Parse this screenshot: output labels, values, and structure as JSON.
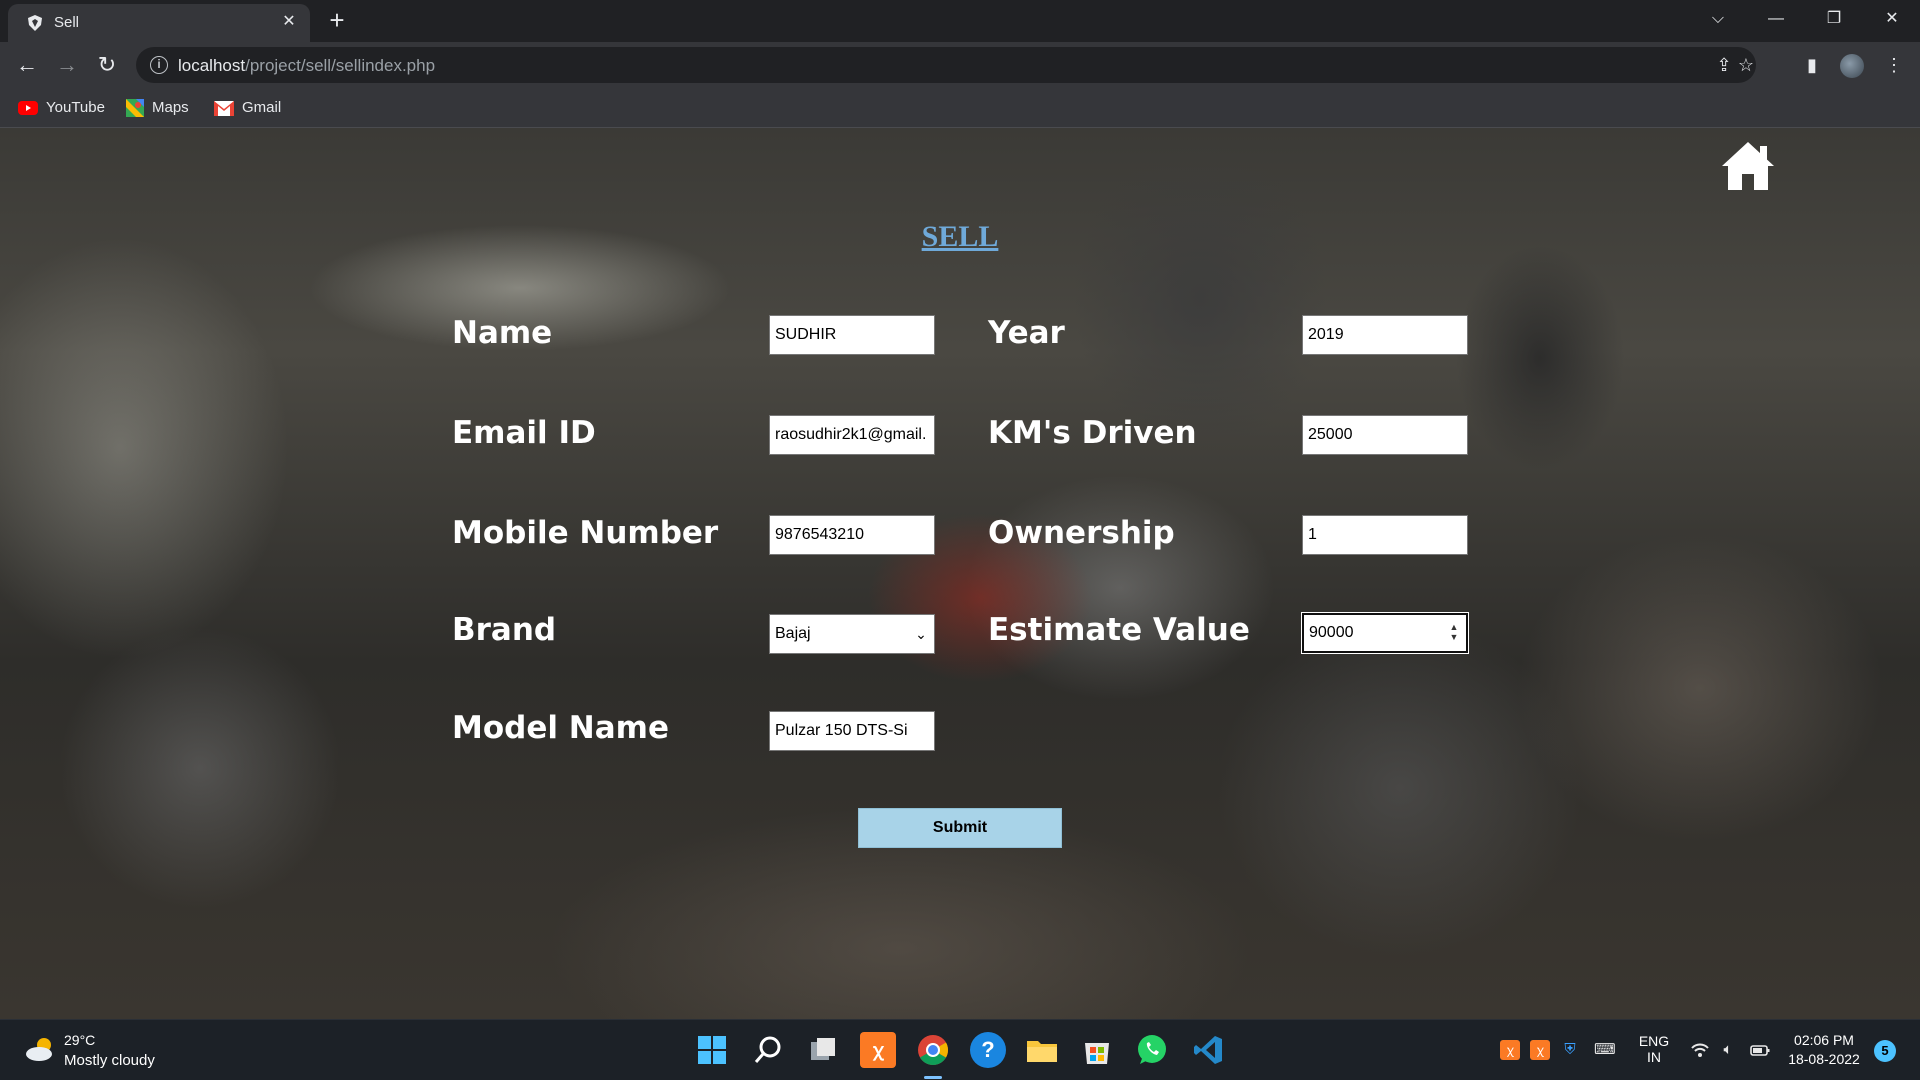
{
  "browser": {
    "tab_title": "Sell",
    "tab_close": "✕",
    "new_tab": "+",
    "url_host": "localhost",
    "url_path": "/project/sell/sellindex.php",
    "bookmarks": [
      "YouTube",
      "Maps",
      "Gmail"
    ]
  },
  "page": {
    "title": "SELL",
    "fields": {
      "name": {
        "label": "Name",
        "value": "SUDHIR"
      },
      "email": {
        "label": "Email ID",
        "value": "raosudhir2k1@gmail."
      },
      "mobile": {
        "label": "Mobile Number",
        "value": "9876543210"
      },
      "brand": {
        "label": "Brand",
        "value": "Bajaj"
      },
      "model": {
        "label": "Model Name",
        "value": "Pulzar 150 DTS-Si"
      },
      "year": {
        "label": "Year",
        "value": "2019"
      },
      "km": {
        "label": "KM's Driven",
        "value": "25000"
      },
      "ownership": {
        "label": "Ownership",
        "value": "1"
      },
      "estimate": {
        "label": "Estimate Value",
        "value": "90000"
      }
    },
    "submit_label": "Submit"
  },
  "taskbar": {
    "weather_temp": "29°C",
    "weather_desc": "Mostly cloudy",
    "lang_top": "ENG",
    "lang_bottom": "IN",
    "time": "02:06 PM",
    "date": "18-08-2022",
    "notification_count": "5"
  },
  "colors": {
    "title_link": "#6fa9d9",
    "submit_bg": "#a8d3e8",
    "chrome_dark": "#202124",
    "chrome_toolbar": "#35363a",
    "taskbar_bg": "#1c2127"
  },
  "icons": {
    "home": "home-icon",
    "tab_favicon": "shield-logo-icon"
  }
}
